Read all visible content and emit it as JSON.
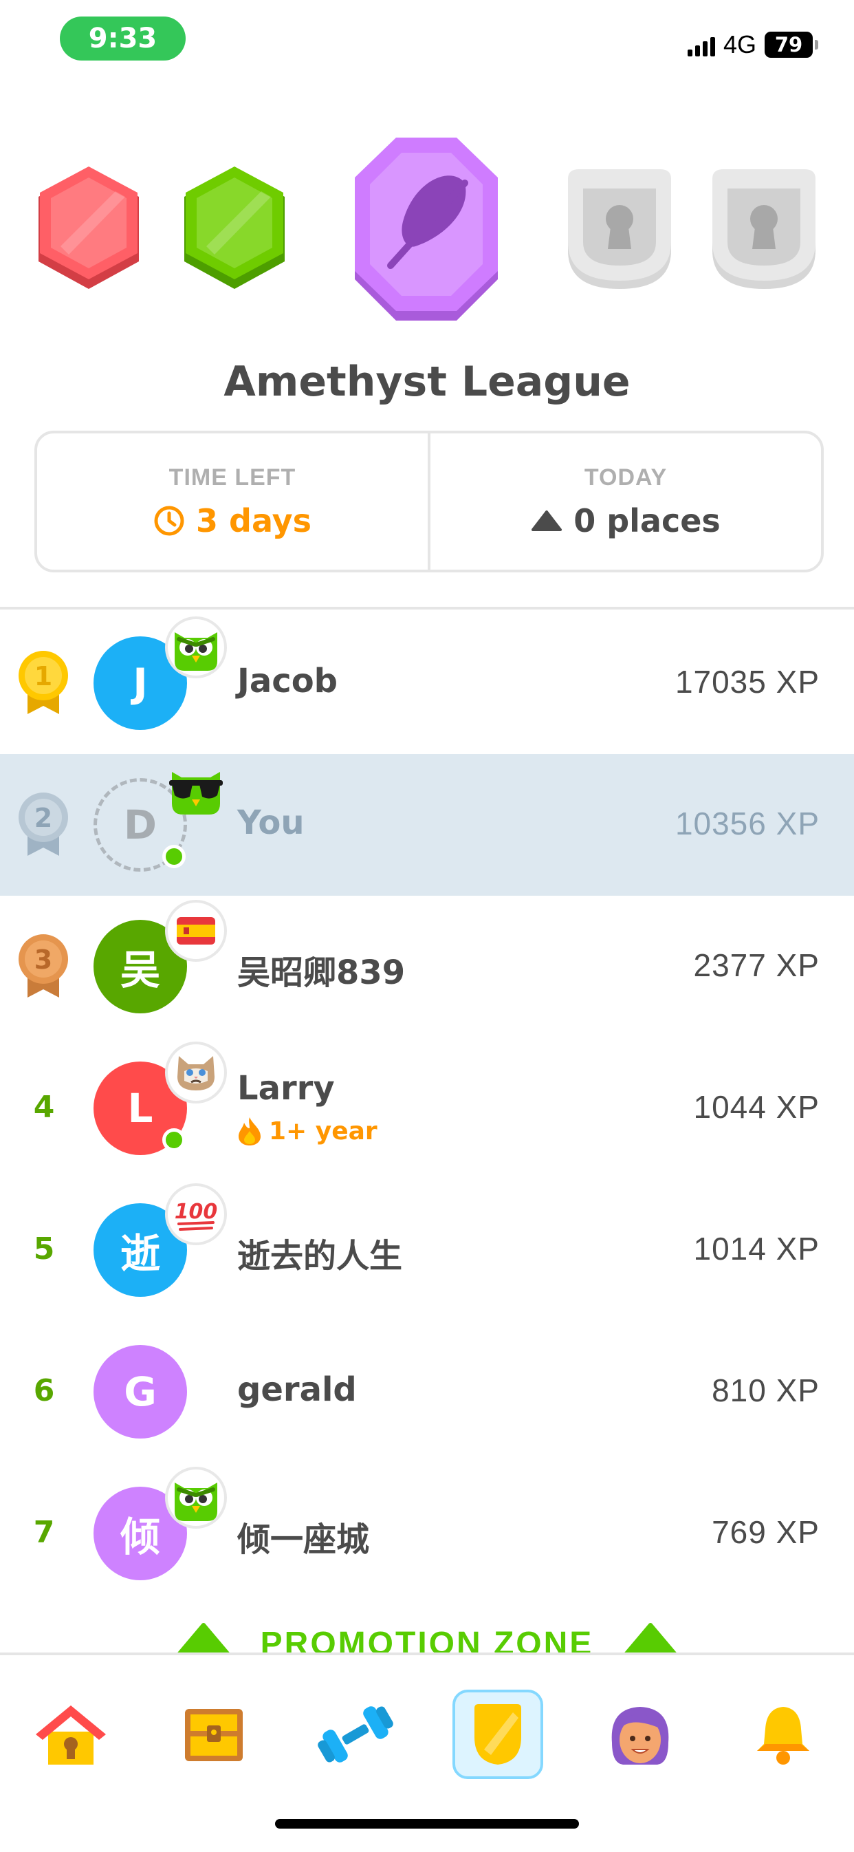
{
  "status_bar": {
    "time": "9:33",
    "network": "4G",
    "battery": "79"
  },
  "league": {
    "title": "Amethyst League",
    "time_left_label": "TIME LEFT",
    "time_left_value": "3 days",
    "today_label": "TODAY",
    "today_value": "0 places",
    "badges": [
      "ruby-league-badge",
      "emerald-league-badge",
      "amethyst-league-badge",
      "locked-league-badge",
      "locked-league-badge"
    ]
  },
  "leaderboard": [
    {
      "rank": "1",
      "initial": "J",
      "name": "Jacob",
      "xp": "17035 XP",
      "avatar_color": "#1cb0f6",
      "badge": "duo-owl-icon",
      "online": false
    },
    {
      "rank": "2",
      "initial": "D",
      "name": "You",
      "xp": "10356 XP",
      "avatar_color": "transparent",
      "badge": "duo-sunglasses-icon",
      "online": true,
      "is_current_user": true
    },
    {
      "rank": "3",
      "initial": "吴",
      "name": "吴昭卿839",
      "xp": "2377 XP",
      "avatar_color": "#58a700",
      "badge": "spain-flag-icon",
      "online": false
    },
    {
      "rank": "4",
      "initial": "L",
      "name": "Larry",
      "xp": "1044 XP",
      "avatar_color": "#ff4b4b",
      "badge": "grumpy-cat-icon",
      "online": true,
      "streak": "1+ year"
    },
    {
      "rank": "5",
      "initial": "逝",
      "name": "逝去的人生",
      "xp": "1014 XP",
      "avatar_color": "#1cb0f6",
      "badge": "hundred-points-icon",
      "online": false
    },
    {
      "rank": "6",
      "initial": "G",
      "name": "gerald",
      "xp": "810 XP",
      "avatar_color": "#ce82ff",
      "badge": "",
      "online": false
    },
    {
      "rank": "7",
      "initial": "倾",
      "name": "倾一座城",
      "xp": "769 XP",
      "avatar_color": "#ce82ff",
      "badge": "duo-owl-icon",
      "online": false
    }
  ],
  "promotion_zone_label": "PROMOTION ZONE",
  "bottom_nav": [
    "home-icon",
    "treasure-chest-icon",
    "dumbbell-icon",
    "leaderboard-shield-icon",
    "profile-avatar-icon",
    "notifications-bell-icon"
  ],
  "colors": {
    "accent_green": "#58cc02",
    "streak_orange": "#ff9600",
    "highlight_row": "#dde8f0"
  }
}
